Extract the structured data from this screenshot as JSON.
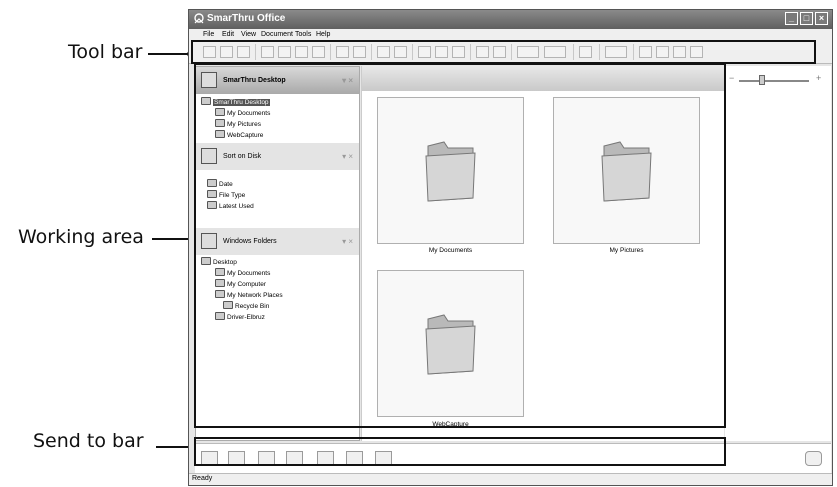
{
  "callouts": {
    "toolbar": "Tool bar",
    "working": "Working area",
    "sendto": "Send to bar"
  },
  "window": {
    "title": "SmarThru Office",
    "min_glyph": "_",
    "max_glyph": "□",
    "close_glyph": "×"
  },
  "menu": [
    "File",
    "Edit",
    "View",
    "Document",
    "Tools",
    "Help"
  ],
  "panels": {
    "desktop": {
      "title": "SmarThru Desktop",
      "ctrl": "▾ ×",
      "root": "SmarThru Desktop",
      "items": [
        "My Documents",
        "My Pictures",
        "WebCapture"
      ]
    },
    "sort": {
      "title": "Sort on Disk",
      "ctrl": "▾ ×",
      "items": [
        "Date",
        "File Type",
        "Latest Used"
      ]
    },
    "folders": {
      "title": "Windows Folders",
      "ctrl": "▾ ×",
      "root": "Desktop",
      "items": [
        "My Documents",
        "My Computer",
        "My Network Places",
        "Recycle Bin",
        "Driver-Elbruz"
      ]
    }
  },
  "thumbnails": [
    "My Documents",
    "My Pictures",
    "WebCapture"
  ],
  "zoom": {
    "minus": "−",
    "plus": "+"
  },
  "status": "Ready"
}
